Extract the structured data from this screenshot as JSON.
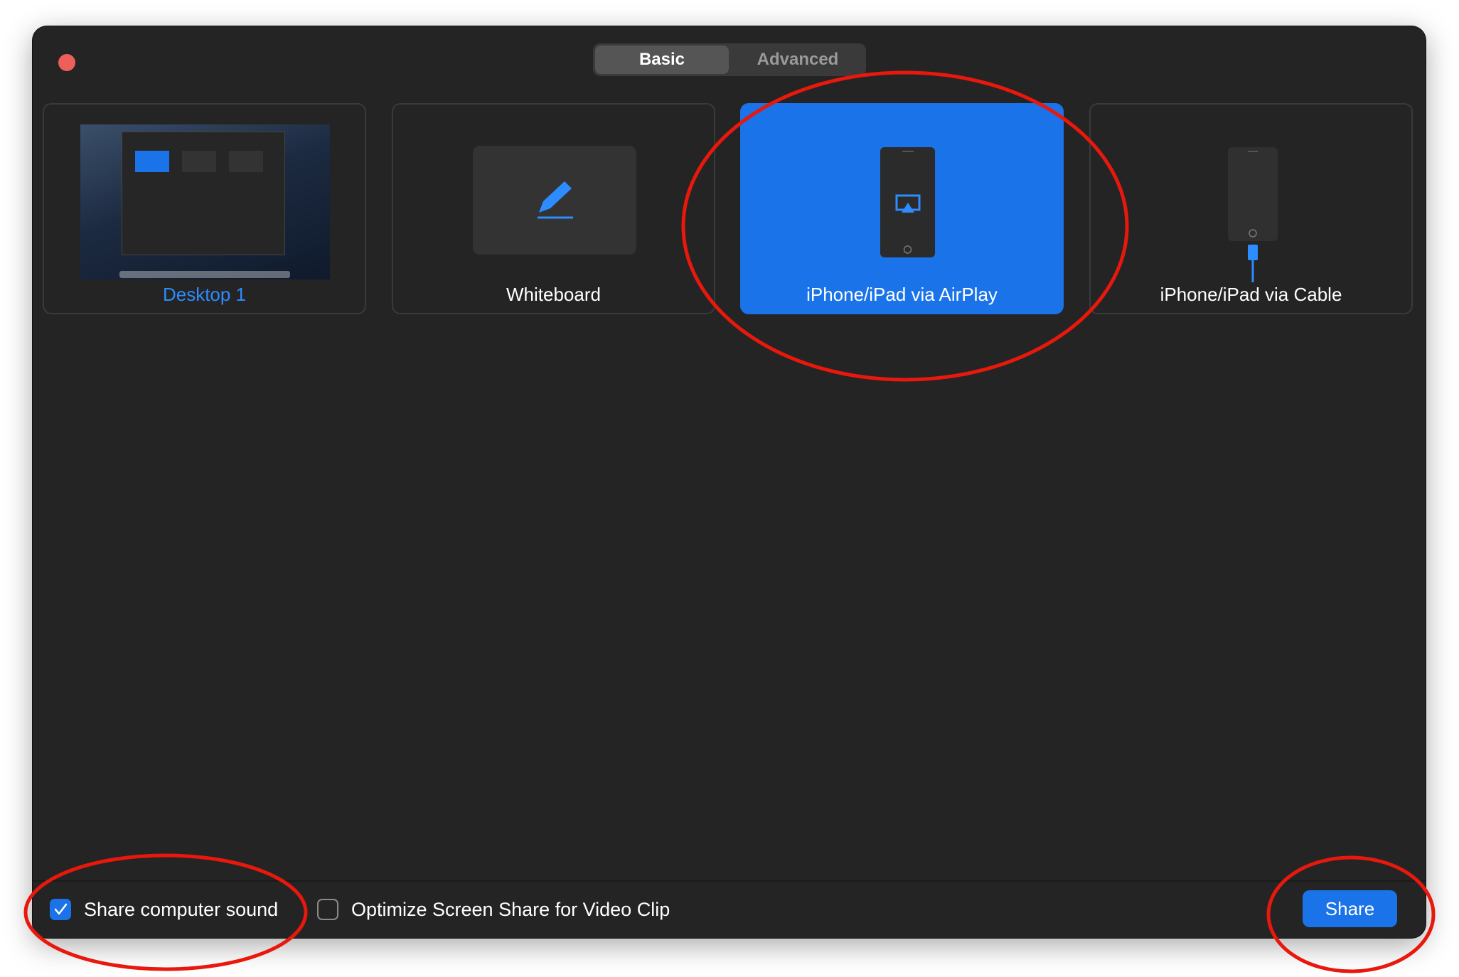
{
  "window": {
    "close_button": "close"
  },
  "tabs": [
    {
      "label": "Basic",
      "selected": true
    },
    {
      "label": "Advanced",
      "selected": false
    }
  ],
  "tiles": [
    {
      "label": "Desktop 1",
      "icon": "desktop-thumbnail"
    },
    {
      "label": "Whiteboard",
      "icon": "pencil-icon"
    },
    {
      "label": "iPhone/iPad via AirPlay",
      "icon": "airplay-phone-icon",
      "selected": true
    },
    {
      "label": "iPhone/iPad via Cable",
      "icon": "cable-phone-icon"
    }
  ],
  "footer": {
    "share_sound": {
      "label": "Share computer sound",
      "checked": true
    },
    "optimize_video": {
      "label": "Optimize Screen Share for Video Clip",
      "checked": false
    },
    "share_button": "Share"
  },
  "colors": {
    "accent": "#1a73e8",
    "background": "#242424",
    "annotation": "#e8180c"
  }
}
